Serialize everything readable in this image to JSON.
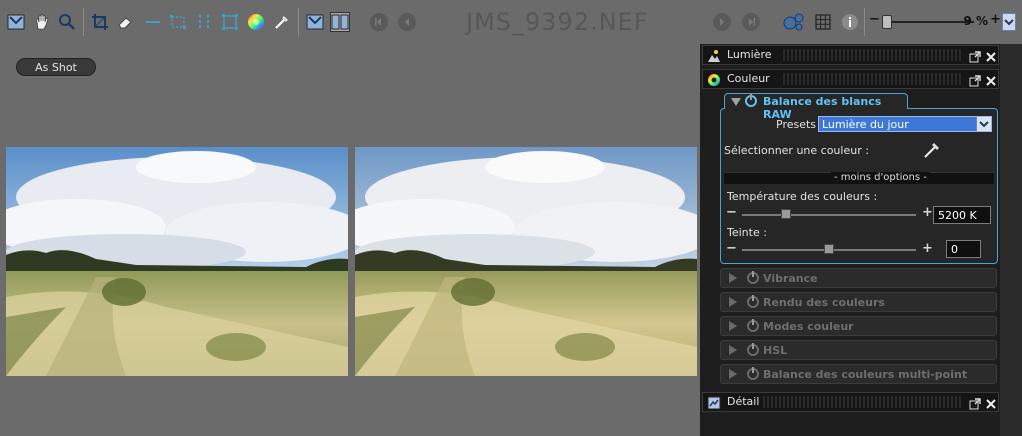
{
  "toolbar": {
    "file_title": "JMS_9392.NEF",
    "zoom_value": "9 %",
    "zoom_fraction": 0.09
  },
  "as_shot_label": "As Shot",
  "panel": {
    "lumiere_label": "Lumière",
    "couleur_label": "Couleur",
    "wb_title": "Balance des blancs RAW",
    "presets_label": "Presets",
    "presets_value": "Lumière du jour",
    "select_color_label": "Sélectionner une couleur :",
    "less_options_label": "- moins d'options -",
    "temp_label": "Température des couleurs :",
    "temp_value": "5200 K",
    "temp_fraction": 0.24,
    "tint_label": "Teinte :",
    "tint_value": "0",
    "tint_fraction": 0.5,
    "sub_sections": [
      "Vibrance",
      "Rendu des couleurs",
      "Modes couleur",
      "HSL",
      "Balance des couleurs multi-point"
    ],
    "detail_label": "Détail"
  },
  "colors": {
    "accent": "#5ec3f4",
    "panel_bg": "#1e1e1e",
    "select_bg": "#3d78d8"
  }
}
